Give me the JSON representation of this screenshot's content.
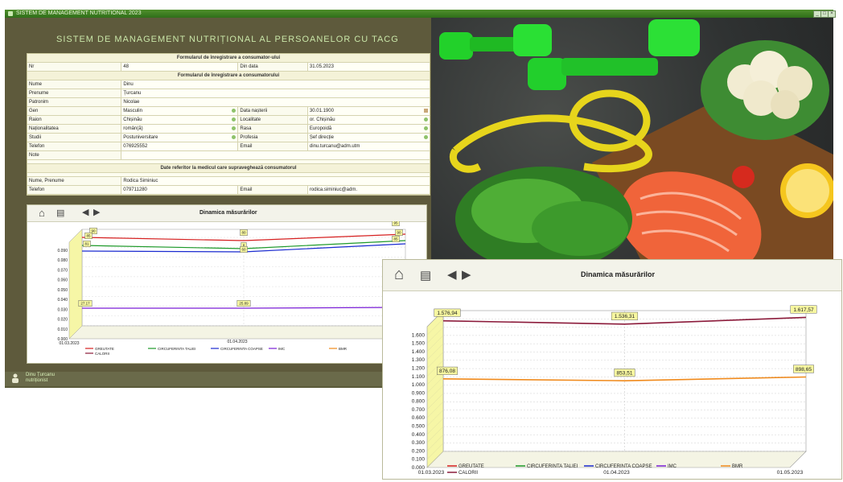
{
  "window": {
    "title": "SISTEM DE MANAGEMENT NUTRITIONAL 2023"
  },
  "app_title": "SISTEM DE MANAGEMENT NUTRIȚIONAL AL PERSOANELOR CU TACG",
  "form": {
    "header1": "Formularul de înregistrare a consumator-ului",
    "nr_label": "Nr",
    "nr_value": "48",
    "date_label": "Din data",
    "date_value": "31.05.2023",
    "header2": "Formularul de înregistrare a consumatorului",
    "name_label": "Nume",
    "name_value": "Dinu",
    "surname_label": "Prenume",
    "surname_value": "Țurcanu",
    "patronim_label": "Patronim",
    "patronim_value": "Nicolae",
    "gen_label": "Gen",
    "gen_value": "Masculin",
    "birth_label": "Data nașterii",
    "birth_value": "30.01.1900",
    "raion_label": "Raion",
    "raion_value": "Chișinău",
    "loc_label": "Localitate",
    "loc_value": "or. Chișinău",
    "nat_label": "Naționalitatea",
    "nat_value": "român(ă)",
    "rasa_label": "Rasa",
    "rasa_value": "Europoidă",
    "studii_label": "Studii",
    "studii_value": "Postuniversitare",
    "prof_label": "Profesia",
    "prof_value": "Șef direcție",
    "tel_label": "Telefon",
    "tel_value": "076925552",
    "email_label": "Email",
    "email_value": "dinu.turcanu@adm.utm",
    "note_label": "Note",
    "note_value": "",
    "header3": "Date referitor la medicul care supraveghează consumatorul",
    "doc_name_label": "Nume, Prenume",
    "doc_name_value": "Rodica Siminiuc",
    "doc_tel_label": "Telefon",
    "doc_tel_value": "079711280",
    "doc_email_label": "Email",
    "doc_email_value": "rodica.siminiuc@adm."
  },
  "toolbar": {
    "home_icon": "home-icon",
    "print_icon": "printer-icon",
    "prev_icon": "arrow-left-icon",
    "next_icon": "arrow-right-icon"
  },
  "chart_small": {
    "title": "Dinamica măsurărilor",
    "yticks": [
      "0.000",
      "0.010",
      "0.020",
      "0.030",
      "0.040",
      "0.050",
      "0.060",
      "0.070",
      "0.080",
      "0.090"
    ],
    "xlabels": [
      "01.03.2023",
      "01.04.2023"
    ],
    "labels_top": [
      "90",
      "85",
      "81",
      "80",
      "8",
      "60",
      "95",
      "90",
      "85"
    ],
    "imc_labels": [
      "27.17",
      "25.89"
    ],
    "legend": [
      "GREUTATE",
      "CIRCUFERINTA TALIEI",
      "CIRCUFERINTA COAPSE",
      "IMC",
      "BMR",
      "CALORII"
    ]
  },
  "chart_large": {
    "title": "Dinamica măsurărilor",
    "yticks": [
      "0.000",
      "0.100",
      "0.200",
      "0.300",
      "0.400",
      "0.500",
      "0.600",
      "0.700",
      "0.800",
      "0.900",
      "1.000",
      "1.100",
      "1.200",
      "1.300",
      "1.400",
      "1.500",
      "1.600"
    ],
    "xlabels": [
      "01.03.2023",
      "01.04.2023",
      "01.05.2023"
    ],
    "calorii_labels": [
      "1.576,94",
      "1.536,31",
      "1.617,57"
    ],
    "bmr_labels": [
      "876,08",
      "853,51",
      "898,65"
    ],
    "legend": [
      "GREUTATE",
      "CIRCUFERINTA TALIEI",
      "CIRCUFERINTA COAPSE",
      "IMC",
      "BMR",
      "CALORII"
    ]
  },
  "chart_data": [
    {
      "type": "line",
      "title": "Dinamica măsurărilor",
      "x": [
        "01.03.2023",
        "01.04.2023",
        "01.05.2023"
      ],
      "series": [
        {
          "name": "CALORII",
          "values": [
            1576.94,
            1536.31,
            1617.57
          ],
          "color": "#8b1a3a"
        },
        {
          "name": "BMR",
          "values": [
            876.08,
            853.51,
            898.65
          ],
          "color": "#f08a1c"
        }
      ],
      "ylim": [
        0,
        1700
      ]
    }
  ],
  "colors": {
    "greutate": "#d62020",
    "talie": "#1f9a2a",
    "coapse": "#1a2ad0",
    "imc": "#7a1fd6",
    "bmr": "#f08a1c",
    "calorii": "#8b1a3a",
    "wall": "#f6f6a6",
    "label_bg": "#f7f7a0"
  },
  "user": {
    "name": "Dinu Țurcanu",
    "role": "nutriționist"
  }
}
